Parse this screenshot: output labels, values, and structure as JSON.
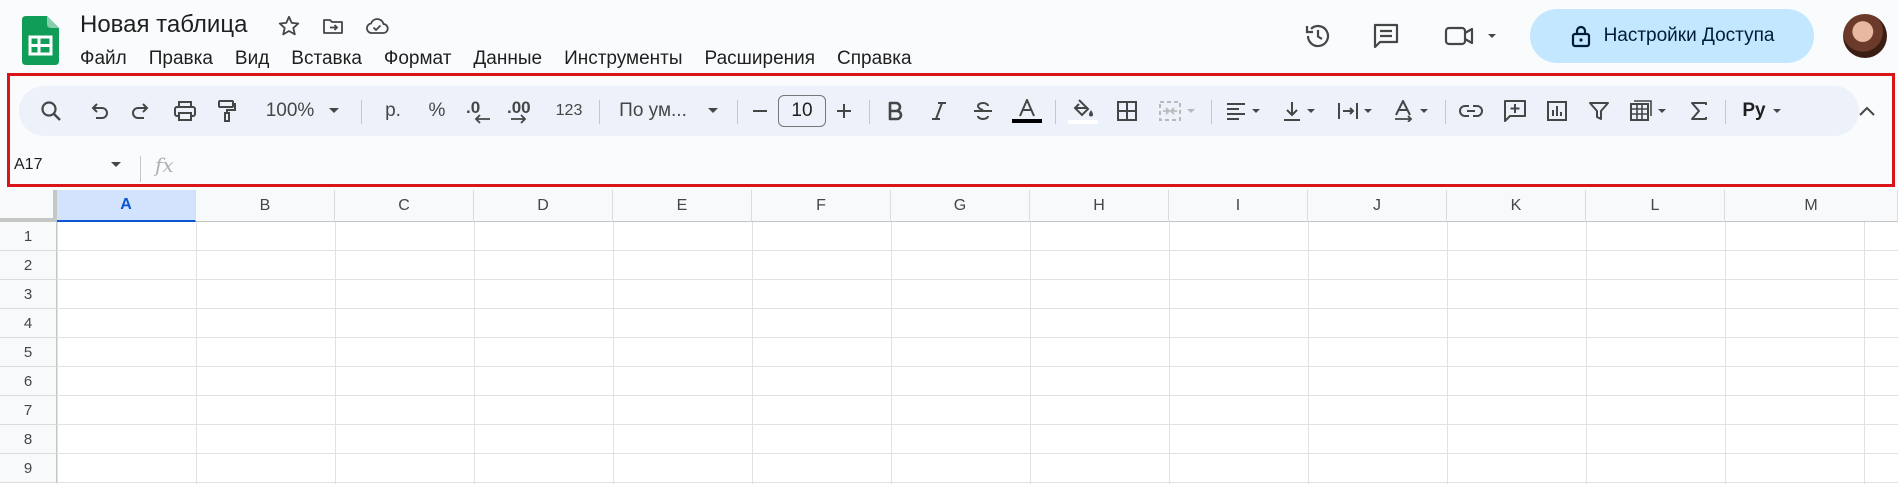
{
  "doc": {
    "title": "Новая таблица"
  },
  "menu": [
    "Файл",
    "Правка",
    "Вид",
    "Вставка",
    "Формат",
    "Данные",
    "Инструменты",
    "Расширения",
    "Справка"
  ],
  "share": {
    "label": "Настройки Доступа"
  },
  "toolbar": {
    "zoom": "100%",
    "currency": "р.",
    "percent": "%",
    "dec_decrease": ".0",
    "dec_increase": ".00",
    "more_formats": "123",
    "font": "По ум...",
    "font_size": "10",
    "text_color": "#000000",
    "fill_color": "#ffffff",
    "input_tools": "Ру"
  },
  "formula_bar": {
    "cell_ref": "A17",
    "fx": "fx"
  },
  "grid": {
    "columns": [
      "A",
      "B",
      "C",
      "D",
      "E",
      "F",
      "G",
      "H",
      "I",
      "J",
      "K",
      "L",
      "M"
    ],
    "rows": [
      "1",
      "2",
      "3",
      "4",
      "5",
      "6",
      "7",
      "8",
      "9"
    ],
    "active_column": "A"
  },
  "colors": {
    "accent": "#0b57d0",
    "share_bg": "#c2e7ff",
    "highlight_frame": "#d9151a",
    "sheets_green": "#0f9d58"
  }
}
